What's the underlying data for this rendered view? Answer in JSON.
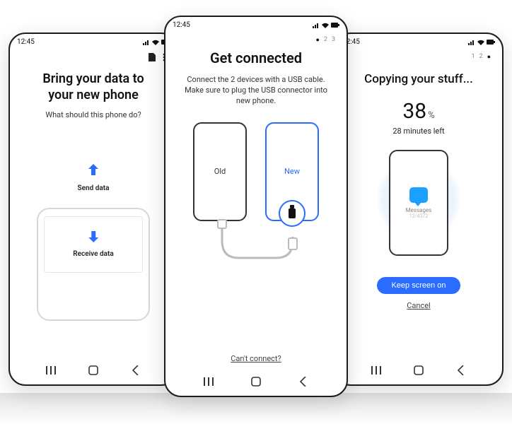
{
  "status": {
    "time": "12:45"
  },
  "left": {
    "title_line1": "Bring your data to",
    "title_line2": "your new phone",
    "subtitle": "What should this phone do?",
    "send_label": "Send data",
    "receive_label": "Receive data"
  },
  "center": {
    "steps": {
      "current": "1",
      "second": "2",
      "third": "3"
    },
    "title": "Get connected",
    "description": "Connect the 2 devices with a USB cable. Make sure to plug the USB connector into new phone.",
    "old_label": "Old",
    "new_label": "New",
    "help_link": "Can't connect?"
  },
  "right": {
    "steps": {
      "first": "1",
      "second": "2",
      "current": "3"
    },
    "title": "Copying your stuff...",
    "percent_value": "38",
    "percent_symbol": "%",
    "time_left": "28 minutes left",
    "item_label": "Messages",
    "item_count": "12/4372",
    "keep_on_label": "Keep screen on",
    "cancel_label": "Cancel"
  }
}
